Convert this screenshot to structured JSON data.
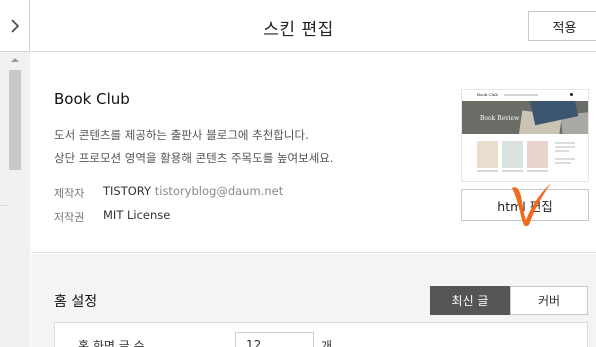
{
  "header": {
    "title": "스킨 편집",
    "apply_label": "적용"
  },
  "skin": {
    "name": "Book Club",
    "description_line1": "도서 콘텐츠를 제공하는 출판사 블로그에 추천합니다.",
    "description_line2": "상단 프로모션 영역을 활용해 콘텐츠 주목도를 높여보세요.",
    "author_label": "제작자",
    "author_name": "TISTORY",
    "author_email": "tistoryblog@daum.net",
    "license_label": "저작권",
    "license_value": "MIT License",
    "thumbnail": {
      "logo_text": "Book Club",
      "hero_text": "Book Review"
    },
    "html_edit_label": "html 편집"
  },
  "home_settings": {
    "title": "홈 설정",
    "tabs": [
      {
        "label": "최신 글",
        "active": true
      },
      {
        "label": "커버",
        "active": false
      }
    ],
    "row_label": "홈 화면 글 수",
    "row_value": "12",
    "row_unit": "개"
  },
  "colors": {
    "check_mark": "#f26a1b",
    "active_tab": "#555555"
  }
}
